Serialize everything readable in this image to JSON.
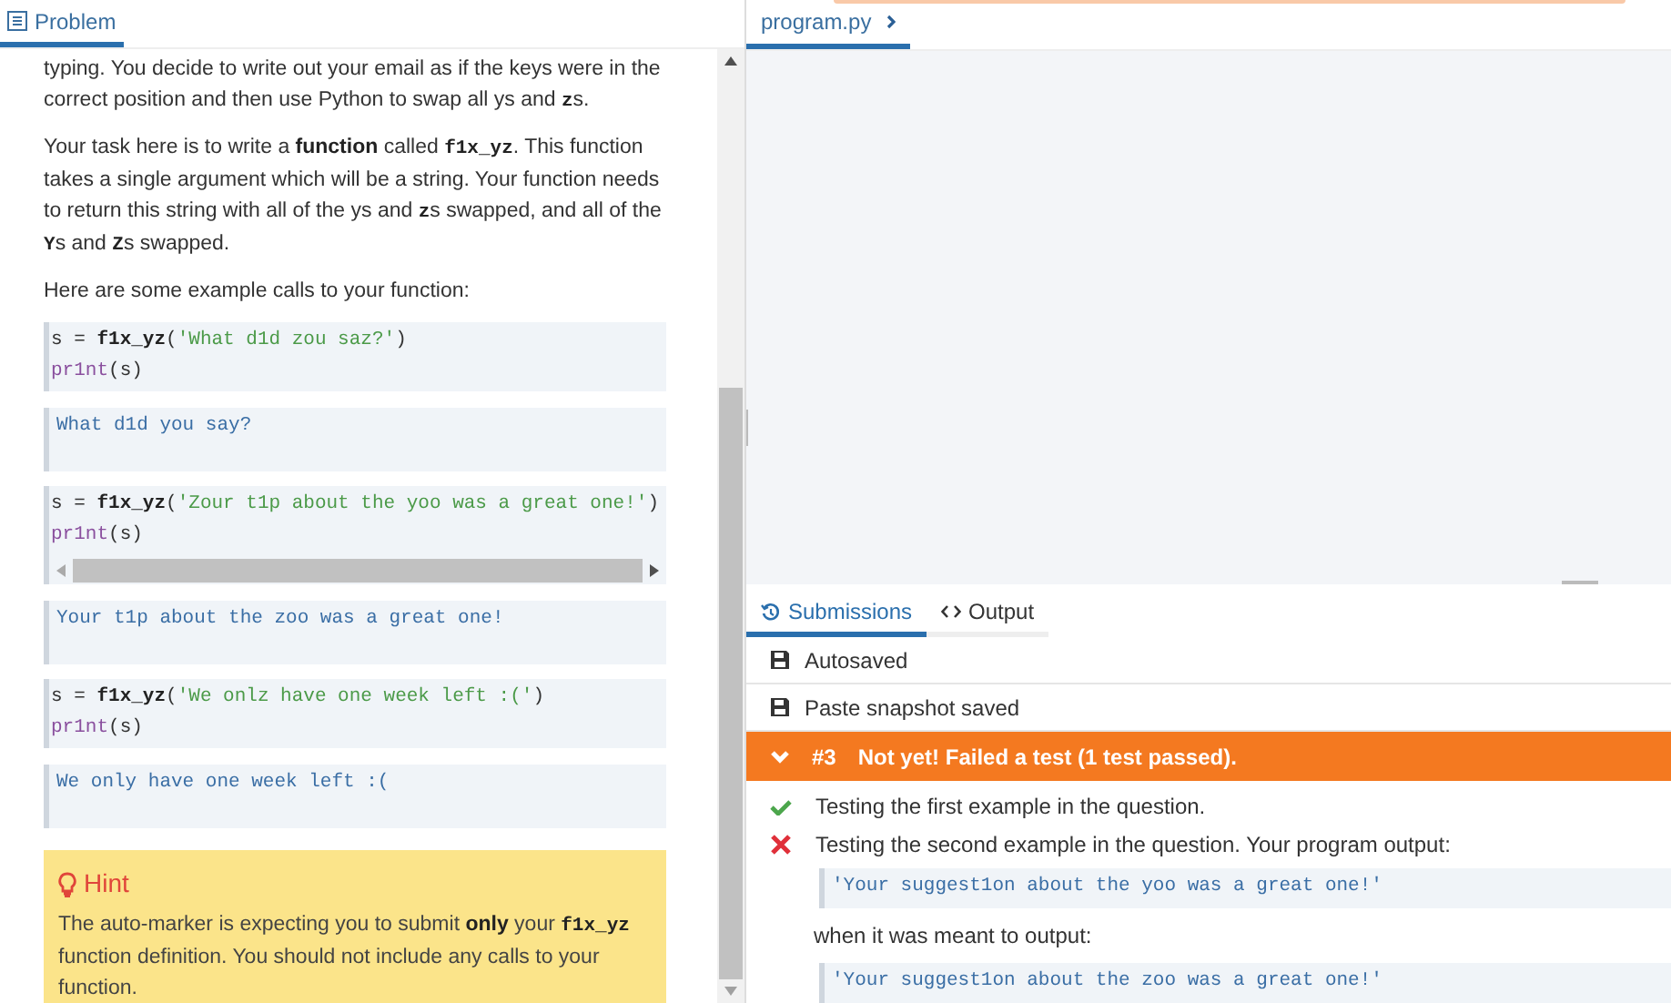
{
  "problem_tab": {
    "label": "Problem",
    "selected": true
  },
  "paragraphs": [
    [
      {
        "kind": "text",
        "text": "typing. You decide to write out your email as if the keys were in the correct position and then use Python to swap all ys and "
      },
      {
        "kind": "code",
        "text": "z"
      },
      {
        "kind": "text",
        "text": "s."
      }
    ],
    [
      {
        "kind": "text",
        "text": "Your task here is to write a "
      },
      {
        "kind": "bold",
        "text": "function"
      },
      {
        "kind": "text",
        "text": " called "
      },
      {
        "kind": "code",
        "text": "f1x_yz"
      },
      {
        "kind": "text",
        "text": ". This function takes a single argument which will be a string. Your function needs to return this string with all of the ys and "
      },
      {
        "kind": "code",
        "text": "z"
      },
      {
        "kind": "text",
        "text": "s swapped, and all of the "
      },
      {
        "kind": "code",
        "text": "Y"
      },
      {
        "kind": "text",
        "text": "s and "
      },
      {
        "kind": "code",
        "text": "Z"
      },
      {
        "kind": "text",
        "text": "s swapped."
      }
    ],
    [
      {
        "kind": "text",
        "text": "Here are some example calls to your function:"
      }
    ]
  ],
  "examples": [
    {
      "code": [
        [
          {
            "kind": "plain",
            "text": "s = "
          },
          {
            "kind": "name",
            "text": "f1x_yz"
          },
          {
            "kind": "plain",
            "text": "("
          },
          {
            "kind": "string",
            "text": "'What d1d zou saz?'"
          },
          {
            "kind": "plain",
            "text": ")"
          }
        ],
        [
          {
            "kind": "builtin",
            "text": "pr1nt"
          },
          {
            "kind": "plain",
            "text": "(s)"
          }
        ]
      ],
      "scrollbar": false,
      "output": "What d1d you say?"
    },
    {
      "code": [
        [
          {
            "kind": "plain",
            "text": "s = "
          },
          {
            "kind": "name",
            "text": "f1x_yz"
          },
          {
            "kind": "plain",
            "text": "("
          },
          {
            "kind": "string",
            "text": "'Zour t1p about the yoo was a great one!'"
          },
          {
            "kind": "plain",
            "text": ")"
          }
        ],
        [
          {
            "kind": "builtin",
            "text": "pr1nt"
          },
          {
            "kind": "plain",
            "text": "(s)"
          }
        ]
      ],
      "scrollbar": true,
      "output": "Your t1p about the zoo was a great one!"
    },
    {
      "code": [
        [
          {
            "kind": "plain",
            "text": "s = "
          },
          {
            "kind": "name",
            "text": "f1x_yz"
          },
          {
            "kind": "plain",
            "text": "("
          },
          {
            "kind": "string",
            "text": "'We onlz have one week left :('"
          },
          {
            "kind": "plain",
            "text": ")"
          }
        ],
        [
          {
            "kind": "builtin",
            "text": "pr1nt"
          },
          {
            "kind": "plain",
            "text": "(s)"
          }
        ]
      ],
      "scrollbar": false,
      "output": "We only have one week left :("
    }
  ],
  "hint": {
    "title": "Hint",
    "text": [
      {
        "kind": "text",
        "text": "The auto-marker is expecting you to submit "
      },
      {
        "kind": "bold",
        "text": "only"
      },
      {
        "kind": "text",
        "text": " your "
      },
      {
        "kind": "code",
        "text": "f1x_yz"
      },
      {
        "kind": "text",
        "text": " function definition. You should not include any calls to your function."
      }
    ]
  },
  "editor_tab": {
    "label": "program.py",
    "selected": true
  },
  "bottom_tabs": [
    {
      "kind": "history",
      "label": "Submissions",
      "selected": true
    },
    {
      "kind": "code",
      "label": "Output",
      "selected": false
    }
  ],
  "events": [
    {
      "text": "Autosaved"
    },
    {
      "text": "Paste snapshot saved"
    }
  ],
  "submission": {
    "number": "#3",
    "message": "Not yet! Failed a test (1 test passed).",
    "expanded": true,
    "results": [
      {
        "passed": true,
        "text": "Testing the first example in the question."
      },
      {
        "passed": false,
        "text": "Testing the second example in the question. Your program output:",
        "output": "'Your suggest1on about the yoo was a great one!'",
        "expected_label": "when it was meant to output:",
        "expected": "'Your suggest1on about the zoo was a great one!'"
      }
    ]
  }
}
